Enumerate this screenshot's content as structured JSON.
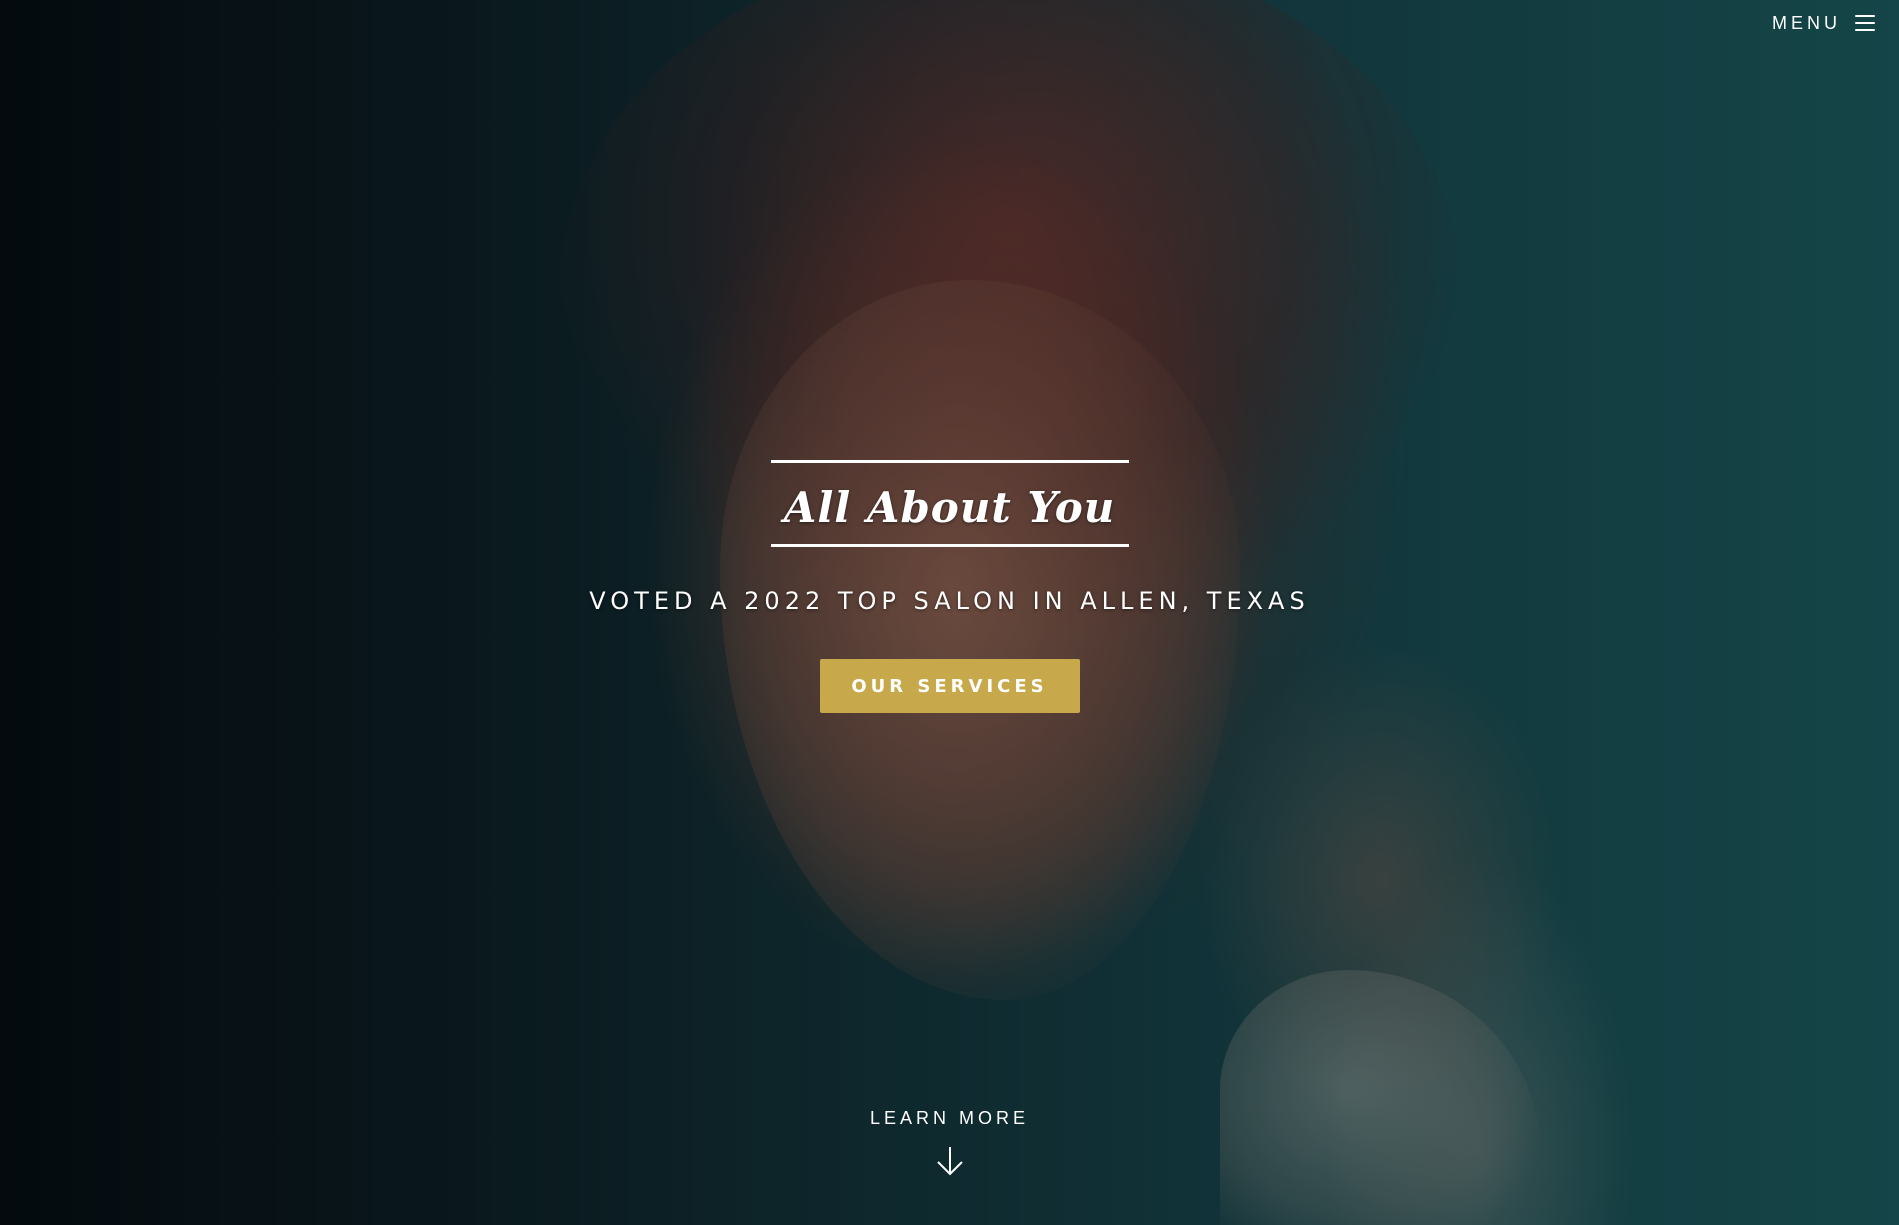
{
  "header": {
    "menu_label": "MENU",
    "menu_icon": "hamburger-icon"
  },
  "hero": {
    "title": "All About You",
    "subtitle": "VOTED A 2022 TOP SALON IN ALLEN, TEXAS",
    "cta_label": "OUR SERVICES",
    "cta_color": "#c7a84b",
    "learn_more_label": "LEARN MORE",
    "learn_more_icon": "arrow-down-icon"
  }
}
